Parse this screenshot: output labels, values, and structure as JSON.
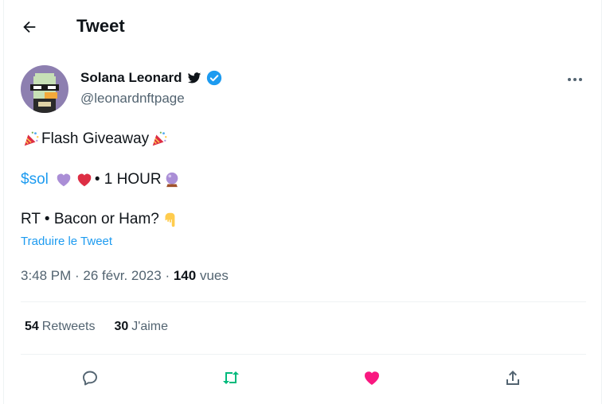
{
  "header": {
    "title": "Tweet"
  },
  "user": {
    "name": "Solana Leonard",
    "handle": "@leonardnftpage"
  },
  "tweet": {
    "line1": "Flash Giveaway",
    "cashtag": "$sol",
    "line2_rest": " • 1 HOUR",
    "line3": "RT • Bacon or Ham? ",
    "translate": "Traduire le Tweet"
  },
  "meta": {
    "time": "3:48 PM",
    "date": "26 févr. 2023",
    "views": "140",
    "views_label": "vues",
    "sep": " · "
  },
  "stats": {
    "retweets_count": "54",
    "retweets_label": "Retweets",
    "likes_count": "30",
    "likes_label": "J'aime"
  },
  "colors": {
    "accent": "#1d9bf0",
    "retweet": "#00ba7c",
    "like": "#f91880",
    "muted": "#536471"
  },
  "icons": [
    "back-arrow-icon",
    "bird-icon",
    "verified-badge-icon",
    "more-icon",
    "party-popper-icon",
    "purple-heart-icon",
    "red-heart-icon",
    "crystal-ball-icon",
    "pointing-down-icon",
    "reply-icon",
    "retweet-icon",
    "like-icon",
    "share-icon"
  ]
}
